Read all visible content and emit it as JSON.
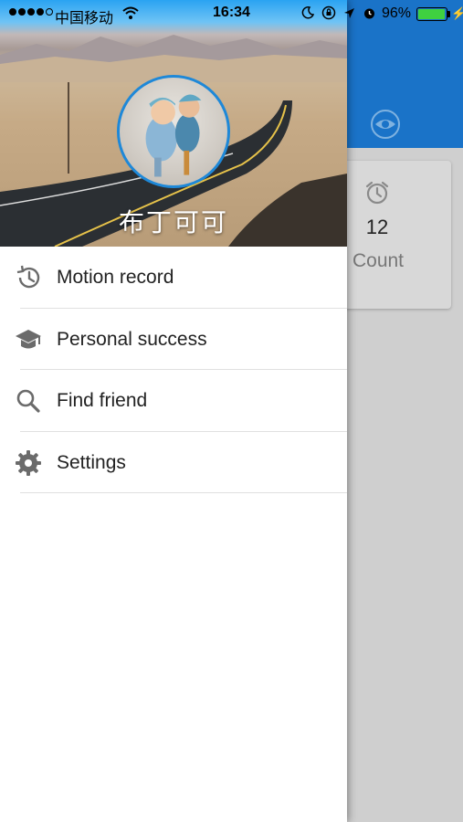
{
  "status_bar": {
    "carrier": "中国移动",
    "time": "16:34",
    "battery_percent": "96%",
    "battery_level": 0.96,
    "battery_color": "#3fd140"
  },
  "background_app": {
    "appbar_color": "#1a73c8",
    "eye_icon": "eye-icon",
    "card": {
      "icon": "alarm-icon",
      "value": "12",
      "label": "Count"
    }
  },
  "drawer": {
    "header": {
      "username": "布丁可可",
      "avatar_border_color": "#1e88d8"
    },
    "menu": [
      {
        "icon": "history-icon",
        "label": "Motion record"
      },
      {
        "icon": "school-icon",
        "label": "Personal success"
      },
      {
        "icon": "search-icon",
        "label": "Find friend"
      },
      {
        "icon": "gear-icon",
        "label": "Settings"
      }
    ]
  }
}
